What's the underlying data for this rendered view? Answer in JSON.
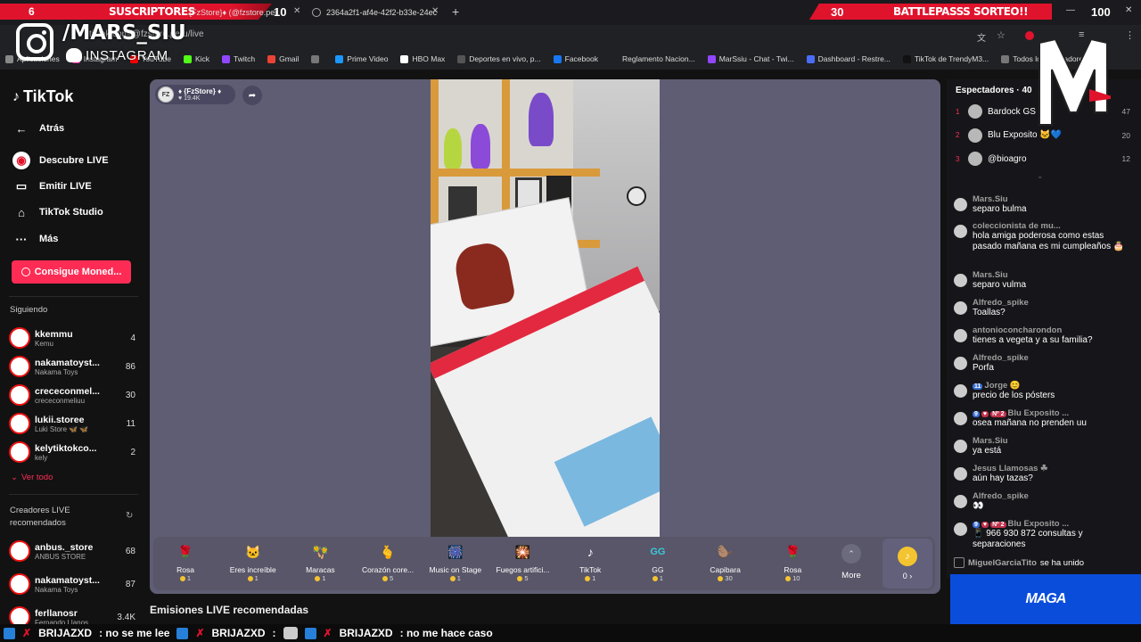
{
  "overlay": {
    "subs_count": "6",
    "subs_label": "SUSCRIPTORES",
    "subs_goal": "10",
    "bp_count": "30",
    "bp_label": "BATTLEPASSS SORTEO!!",
    "bp_goal": "100",
    "instagram_handle": "/MARS_SIU",
    "instagram_label": "INSTAGRAM",
    "maga_label": "MAGA"
  },
  "browser": {
    "tabs": [
      {
        "label": "{FzStore}♦ (@fzstore.per"
      },
      {
        "label": "2364a2f1-af4e-42f2-b33e-24ec"
      }
    ],
    "url": "tiktok.com/@fzstore.peru/live",
    "bookmarks": [
      {
        "label": "Aplicaciones",
        "color": "#888888"
      },
      {
        "label": "Instagram",
        "color": "#d6249f"
      },
      {
        "label": "YouTube",
        "color": "#ff0000"
      },
      {
        "label": "Kick",
        "color": "#53fc18"
      },
      {
        "label": "Twitch",
        "color": "#9146ff"
      },
      {
        "label": "Gmail",
        "color": "#ea4335"
      },
      {
        "label": "",
        "color": "#777777"
      },
      {
        "label": "Prime Video",
        "color": "#1a98ff"
      },
      {
        "label": "HBO Max",
        "color": "#ffffff"
      },
      {
        "label": "Deportes en vivo, p...",
        "color": "#555555"
      },
      {
        "label": "Facebook",
        "color": "#1877f2"
      },
      {
        "label": "Reglamento Nacion...",
        "color": "#202124"
      },
      {
        "label": "MarSsiu - Chat - Twi...",
        "color": "#9146ff"
      },
      {
        "label": "Dashboard - Restre...",
        "color": "#4a6cf7"
      },
      {
        "label": "TikTok de TrendyM3...",
        "color": "#111111"
      },
      {
        "label": "Todos los marcadores",
        "color": "#777777"
      }
    ]
  },
  "sidebar": {
    "logo": "TikTok",
    "nav": [
      {
        "label": "Atrás",
        "icon": "←"
      },
      {
        "label": "Descubre LIVE",
        "icon": "◉"
      },
      {
        "label": "Emitir LIVE",
        "icon": "▭"
      },
      {
        "label": "TikTok Studio",
        "icon": "⌂"
      },
      {
        "label": "Más",
        "icon": "···"
      }
    ],
    "coins_button": "Consigue Moned...",
    "following_title": "Siguiendo",
    "following": [
      {
        "name": "kkemmu",
        "sub": "Kemu",
        "count": "4"
      },
      {
        "name": "nakamatoyst...",
        "sub": "Nakama Toys",
        "count": "86"
      },
      {
        "name": "crececonmel...",
        "sub": "crececonmeliuu",
        "count": "30"
      },
      {
        "name": "lukii.storee",
        "sub": "Luki Store 🦋 🦋",
        "count": "11"
      },
      {
        "name": "kelytiktokco...",
        "sub": "kely",
        "count": "2"
      }
    ],
    "see_all": "Ver todo",
    "recommended_title": "Creadores LIVE recomendados",
    "recommended": [
      {
        "name": "anbus._store",
        "sub": "ANBUS STORE",
        "count": "68"
      },
      {
        "name": "nakamatoyst...",
        "sub": "Nakama Toys",
        "count": "87"
      },
      {
        "name": "ferllanosr",
        "sub": "Fernando Llanos",
        "count": "3.4K"
      }
    ]
  },
  "stream": {
    "host_name": "♦ {FzStore} ♦",
    "host_likes": "19.4K",
    "recommended_title": "Emisiones LIVE recomendadas"
  },
  "gifts": [
    {
      "name": "Rosa",
      "cost": "1",
      "icon": "🌹"
    },
    {
      "name": "Eres increíble",
      "cost": "1",
      "icon": "🐱"
    },
    {
      "name": "Maracas",
      "cost": "1",
      "icon": "🪇"
    },
    {
      "name": "Corazón core...",
      "cost": "5",
      "icon": "🫰"
    },
    {
      "name": "Music on Stage",
      "cost": "1",
      "icon": "🎆"
    },
    {
      "name": "Fuegos artifici...",
      "cost": "5",
      "icon": "🎇"
    },
    {
      "name": "TikTok",
      "cost": "1",
      "icon": "♪"
    },
    {
      "name": "GG",
      "cost": "1",
      "icon": "GG"
    },
    {
      "name": "Capibara",
      "cost": "30",
      "icon": "🦫"
    },
    {
      "name": "Rosa",
      "cost": "10",
      "icon": "🌹"
    }
  ],
  "more_label": "More",
  "wallet_balance": "0 ›",
  "viewers": {
    "title": "Espectadores · 40",
    "top": [
      {
        "rank": "1",
        "name": "Bardock GS",
        "score": "47"
      },
      {
        "rank": "2",
        "name": "Blu Exposito 🐱💙",
        "score": "20"
      },
      {
        "rank": "3",
        "name": "@bioagro",
        "score": "12"
      }
    ]
  },
  "chat": [
    {
      "user": "Mars.Siu",
      "text": "separo bulma",
      "badges": []
    },
    {
      "user": "coleccionista de mu...",
      "text": "hola amiga poderosa como estas pasado mañana es mi cumpleaños 🎂",
      "badges": []
    },
    {
      "user": "Mars.Siu",
      "text": "separo vulma",
      "badges": []
    },
    {
      "user": "Alfredo_spike",
      "text": "Toallas?",
      "badges": []
    },
    {
      "user": "antonioconcharondon",
      "text": "tienes a vegeta y a su familia?",
      "badges": []
    },
    {
      "user": "Alfredo_spike",
      "text": "Porfa",
      "badges": []
    },
    {
      "user": "Jorge 😊",
      "text": "precio de los pósters",
      "badges": [
        "11"
      ]
    },
    {
      "user": "Blu Exposito ...",
      "text": "osea mañana no prenden uu",
      "badges": [
        "9",
        "♥",
        "Nº 2"
      ]
    },
    {
      "user": "Mars.Siu",
      "text": "ya está",
      "badges": []
    },
    {
      "user": "Jesus Llamosas ☘",
      "text": "aún hay tazas?",
      "badges": []
    },
    {
      "user": "Alfredo_spike",
      "text": "👀",
      "badges": []
    },
    {
      "user": "Blu Exposito ...",
      "text": "📱 966 930 872 consultas y separaciones",
      "badges": [
        "9",
        "♥",
        "Nº 2"
      ]
    }
  ],
  "joined": {
    "user": "MiguelGarciaTito",
    "text": "se ha unido"
  },
  "ticker": [
    {
      "user": "BRIJAZXD",
      "text": ": no se me lee"
    },
    {
      "user": "BRIJAZXD",
      "text": ":"
    },
    {
      "user": "BRIJAZXD",
      "text": ": no me hace caso"
    }
  ],
  "colors": {
    "tiktok_red": "#fe2c55",
    "overlay_red": "#e0132c",
    "stream_bg": "#5f5d74",
    "maga_blue": "#0a4ddb"
  }
}
